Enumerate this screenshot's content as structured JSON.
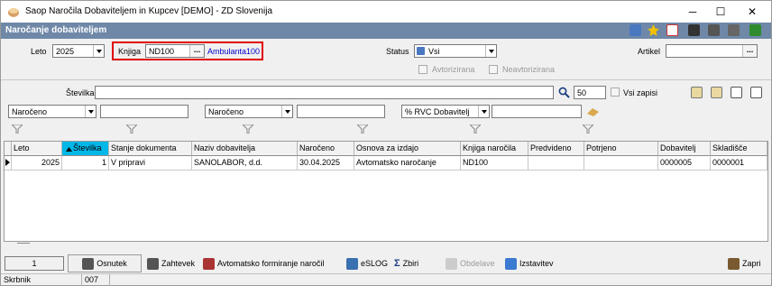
{
  "window": {
    "title": "Saop  Naročila Dobaviteljem in Kupcev [DEMO] - ZD Slovenija",
    "min": "─",
    "max": "☐",
    "close": "✕"
  },
  "header": {
    "title": "Naročanje dobaviteljem"
  },
  "filters": {
    "leto_label": "Leto",
    "leto_value": "2025",
    "knjiga_label": "Knjiga",
    "knjiga_value": "ND100",
    "knjiga_link": "Ambulanta100",
    "status_label": "Status",
    "status_value": "Vsi",
    "artikel_label": "Artikel",
    "artikel_value": "",
    "avtorizirana": "Avtorizirana",
    "neavtorizirana": "Neavtorizirana",
    "dots": "..."
  },
  "search": {
    "stevilka_label": "Številka",
    "stevilka_value": "",
    "limit_value": "50",
    "vsi_zapisi": "Vsi zapisi",
    "f1": "Naročeno",
    "f2": "Naročeno",
    "f3": "% RVC Dobavitelj"
  },
  "grid": {
    "columns": [
      "Leto",
      "Številka",
      "Stanje dokumenta",
      "Naziv dobavitelja",
      "Naročeno",
      "Osnova za izdajo",
      "Knjiga naročila",
      "Predvideno",
      "Potrjeno",
      "Dobavitelj",
      "Skladišče"
    ],
    "rows": [
      [
        "2025",
        "1",
        "V pripravi",
        "SANOLABOR, d.d.",
        "30.04.2025",
        "Avtomatsko naročanje",
        "ND100",
        "",
        "",
        "0000005",
        "0000001"
      ]
    ]
  },
  "bottom": {
    "count": "1",
    "osnutek": "Osnutek",
    "zahtevek": "Zahtevek",
    "avtomatsko": "Avtomatsko formiranje naročil",
    "eslog": "eSLOG",
    "zbiri": "Zbiri",
    "obdelave": "Obdelave",
    "izstavitev": "Izstavitev",
    "zapri": "Zapri"
  },
  "status": {
    "user": "Skrbnik",
    "code": "007"
  },
  "colors": {
    "header": "#6f88a8",
    "highlight_border": "#e00000",
    "link": "#0000cc",
    "sort_header": "#00b7e8"
  }
}
